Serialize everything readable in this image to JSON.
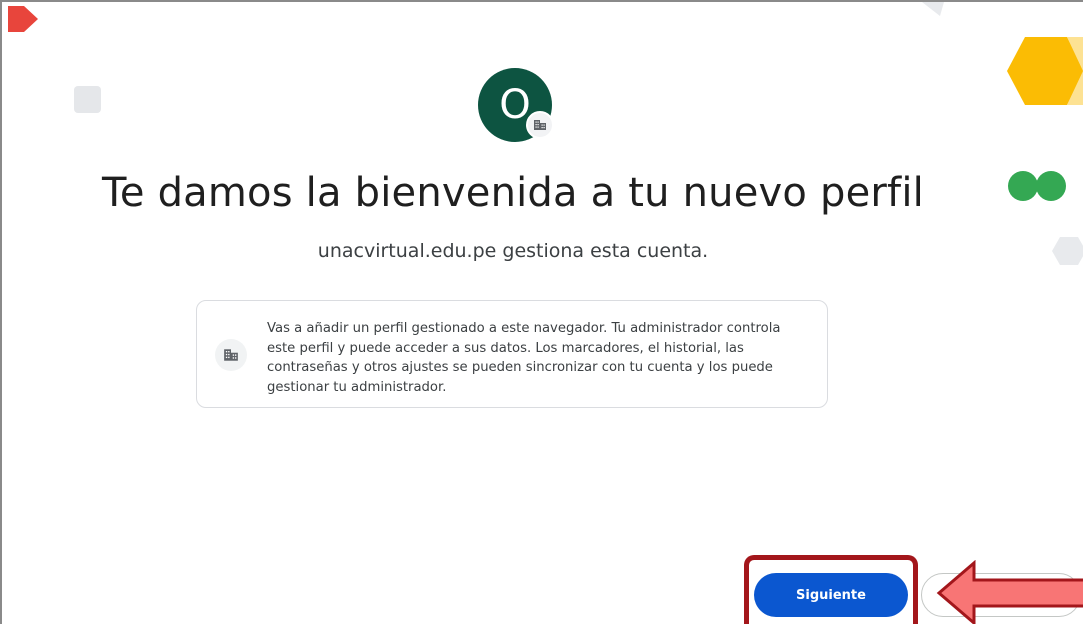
{
  "avatar": {
    "initial": "O",
    "background": "#0d5441",
    "badge_icon": "building-icon"
  },
  "title": "Te damos la bienvenida a tu nuevo perfil",
  "subtitle": "unacvirtual.edu.pe gestiona esta cuenta.",
  "info_card": {
    "icon": "building-icon",
    "text": "Vas a añadir un perfil gestionado a este navegador. Tu administrador controla este perfil y puede acceder a sus datos. Los marcadores, el historial, las contraseñas y otros ajustes se pueden sincronizar con tu cuenta y los puede gestionar tu administrador."
  },
  "actions": {
    "next_label": "Siguiente",
    "next_color": "#0b57d0",
    "secondary_label": ""
  },
  "annotation": {
    "highlight_color": "#a3161b",
    "arrow_color": "#f87575"
  }
}
